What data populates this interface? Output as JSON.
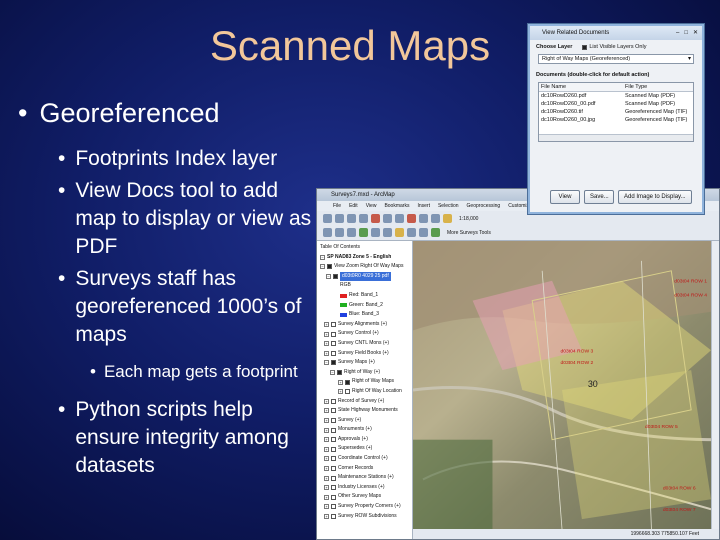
{
  "slide": {
    "title": "Scanned Maps",
    "bullets": {
      "main": "Georeferenced",
      "sub1": "Footprints Index layer",
      "sub2": "View Docs tool to add map to display or view as PDF",
      "sub3": "Surveys staff has georeferenced 1000’s of maps",
      "subsub": "Each map gets a footprint",
      "sub4": "Python scripts help ensure integrity among datasets"
    },
    "bullet_char": "•"
  },
  "arcmap": {
    "title": "Surveys7.mxd - ArcMap",
    "menu": [
      "File",
      "Edit",
      "View",
      "Bookmarks",
      "Insert",
      "Selection",
      "Geoprocessing",
      "Customize"
    ],
    "scale": "1:18,000",
    "surveys_tools": "More Surveys Tools",
    "toc": {
      "header": "Table Of Contents",
      "frame": "SP NAD83 Zone 5 - English",
      "layer1": "View Zoom Right Of Way Maps",
      "raster": "d03t0R0 4029 25 pdf",
      "rgb": "RGB",
      "red": "Red: Band_1",
      "green": "Green: Band_2",
      "blue": "Blue: Band_3",
      "items": [
        "Survey Alignments (+)",
        "Survey Control (+)",
        "Survey CNTL Mons (+)",
        "Survey Field Books (+)",
        "Survey Maps (+)",
        "Right of Way (+)",
        "Right of Way Maps",
        "Right Of Way Location",
        "Record of Survey (+)",
        "State Highway Monuments",
        "Survey (+)",
        "Monuments (+)",
        "Approvals (+)",
        "Supersedes (+)",
        "Coordinate Control (+)",
        "Corner Records",
        "Maintenance Stations (+)",
        "Industry Licenses (+)",
        "Other Survey Maps",
        "Survey Property Corners (+)",
        "Survey ROW Subdivisions"
      ]
    },
    "status_text": "1996668.303  775850.107 Feet",
    "map_labels": [
      "d03t04 ROW 1",
      "d03t04 ROW 4",
      "d03t04 ROW 3",
      "d03t04 ROW 2",
      "d03t04 ROW 5",
      "d03t04 ROW 6",
      "d03t04 ROW 7"
    ],
    "map_center_label": "30"
  },
  "dialog": {
    "title": "View Related Documents",
    "choose_layer": "Choose Layer",
    "visible_only": "List Visible Layers Only",
    "selected_layer": "Right of Way Maps (Georeferenced)",
    "documents_label": "Documents (double-click for default action)",
    "col_name": "File Name",
    "col_type": "File Type",
    "rows": [
      [
        "dc10RowD260.pdf",
        "Scanned Map (PDF)"
      ],
      [
        "dc10RowD260_00.pdf",
        "Scanned Map (PDF)"
      ],
      [
        "dc10RowD260.tif",
        "Georeferenced Map (TIF)"
      ],
      [
        "dc10RowD260_00.jpg",
        "Georeferenced Map (TIF)"
      ]
    ],
    "btn_view": "View",
    "btn_save": "Save...",
    "btn_add": "Add Image to Display..."
  },
  "colors": {
    "background": "#101d66",
    "title": "#f2c79a",
    "text": "#ffffff",
    "dialog_border": "#8fb3dc"
  }
}
